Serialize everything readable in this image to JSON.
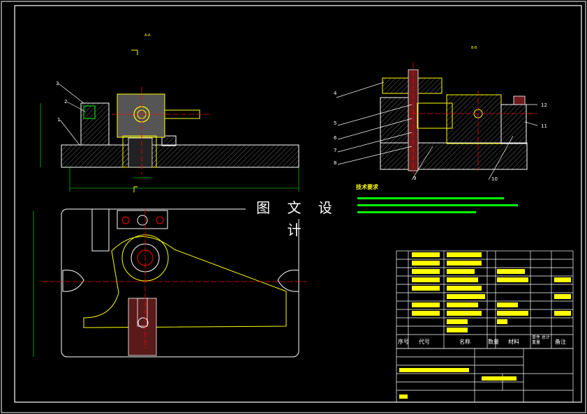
{
  "banner": "图 文 设 计",
  "technical_requirements_title": "技术要求",
  "section_labels": {
    "a": "A-A",
    "b": "B-B"
  },
  "callouts_left": [
    "3",
    "2",
    "1"
  ],
  "callouts_right": [
    "4",
    "5",
    "6",
    "7",
    "8",
    "9",
    "10",
    "11",
    "12"
  ],
  "bom_headers": {
    "seq": "序号",
    "code": "代号",
    "name": "名称",
    "qty": "数量",
    "material": "材料",
    "unit": "单件 总计 重量",
    "remark": "备注"
  },
  "colors": {
    "background": "#000000",
    "frame": "#ffffff",
    "yellow": "#ffff00",
    "red": "#ff0000",
    "green": "#00ff00",
    "hatch": "#aaaaaa",
    "part": "#5a1a1a"
  }
}
